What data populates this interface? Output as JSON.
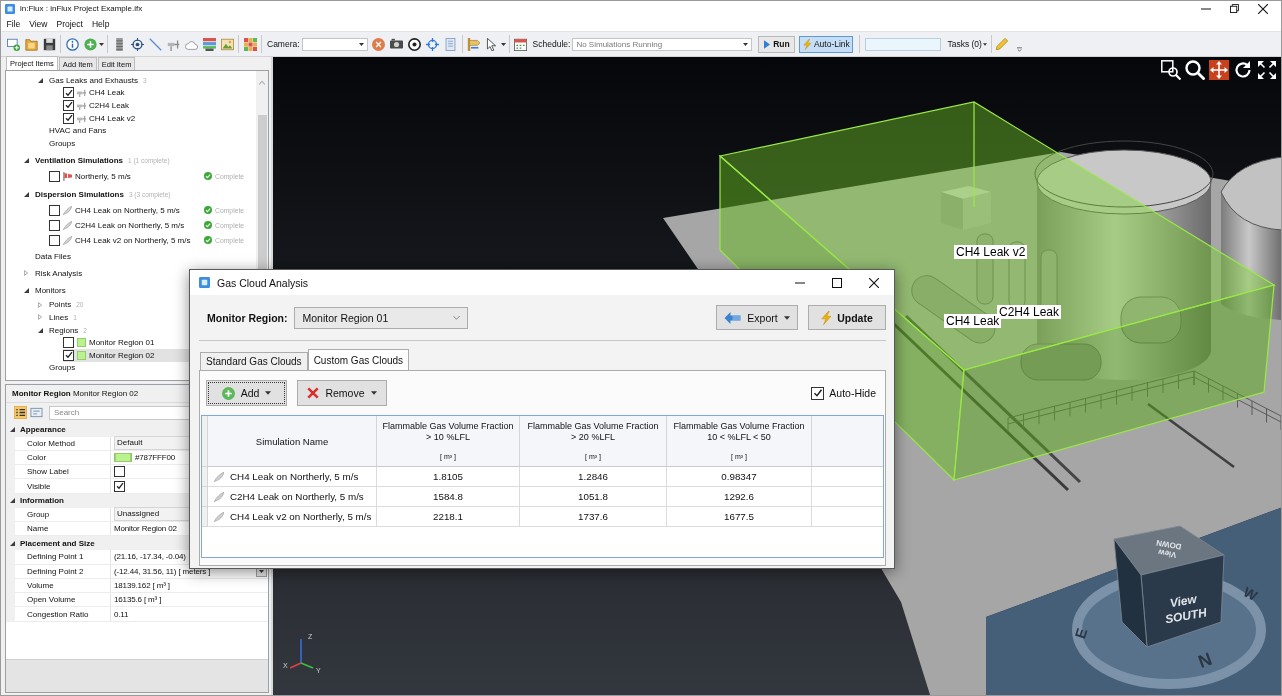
{
  "window": {
    "title": "in:Flux : inFlux Project Example.ifx"
  },
  "menu": [
    {
      "label": "File"
    },
    {
      "label": "View"
    },
    {
      "label": "Project"
    },
    {
      "label": "Help"
    }
  ],
  "toolbar": {
    "camera": {
      "label": "Camera:"
    },
    "schedule": {
      "label": "Schedule:",
      "value": "No Simulations Running"
    },
    "run": {
      "label": "Run"
    },
    "auto_link": {
      "label": "Auto-Link",
      "on": true
    },
    "tasks": {
      "label": "Tasks (0)"
    }
  },
  "left_panel": {
    "tabs": [
      {
        "label": "Project Items",
        "selected": true
      },
      {
        "label": "Add Item",
        "selected": false
      },
      {
        "label": "Edit Item",
        "selected": false
      }
    ],
    "tree": {
      "partial_branch": [
        {
          "kind": "folder",
          "label": "Gas Leaks and Exhausts",
          "count": "3",
          "expanded": true,
          "selected": false,
          "children": [
            {
              "kind": "leak",
              "label": "CH4 Leak",
              "checked": true,
              "selected": false
            },
            {
              "kind": "leak",
              "label": "C2H4 Leak",
              "checked": true,
              "selected": false
            },
            {
              "kind": "leak",
              "label": "CH4 Leak v2",
              "checked": true,
              "selected": false
            }
          ]
        },
        {
          "kind": "folder",
          "label": "HVAC and Fans",
          "selected": false
        },
        {
          "kind": "folder",
          "label": "Groups",
          "selected": false
        }
      ],
      "items": [
        {
          "kind": "section",
          "label": "Ventilation Simulations",
          "count": "1 (1 complete)",
          "expanded": true,
          "selected": false,
          "children": [
            {
              "kind": "ventilation",
              "label": "Northerly, 5 m/s",
              "checked": false,
              "status": "Complete",
              "selected": false
            }
          ]
        },
        {
          "kind": "section",
          "label": "Dispersion Simulations",
          "count": "3 (3 complete)",
          "expanded": true,
          "selected": false,
          "children": [
            {
              "kind": "dispersion",
              "label": "CH4 Leak on Northerly, 5 m/s",
              "checked": false,
              "status": "Complete",
              "selected": false
            },
            {
              "kind": "dispersion",
              "label": "C2H4 Leak on Northerly, 5 m/s",
              "checked": false,
              "status": "Complete",
              "selected": false
            },
            {
              "kind": "dispersion",
              "label": "CH4 Leak v2 on Northerly, 5 m/s",
              "checked": false,
              "status": "Complete",
              "selected": false
            }
          ]
        },
        {
          "kind": "folder",
          "label": "Data Files",
          "selected": false
        },
        {
          "kind": "folder",
          "label": "Risk Analysis",
          "expanded": false,
          "selected": false
        },
        {
          "kind": "folder",
          "label": "Monitors",
          "expanded": true,
          "selected": false,
          "children": [
            {
              "kind": "folder",
              "label": "Points",
              "count": "20",
              "expanded": false,
              "selected": false
            },
            {
              "kind": "folder",
              "label": "Lines",
              "count": "1",
              "expanded": false,
              "selected": false
            },
            {
              "kind": "folder",
              "label": "Regions",
              "count": "2",
              "expanded": true,
              "selected": false,
              "children": [
                {
                  "kind": "region",
                  "label": "Monitor Region 01",
                  "checked": false,
                  "selected": false
                },
                {
                  "kind": "region",
                  "label": "Monitor Region 02",
                  "checked": true,
                  "selected": true
                }
              ]
            },
            {
              "kind": "folder",
              "label": "Groups",
              "selected": false
            }
          ]
        }
      ]
    }
  },
  "properties": {
    "header": {
      "type": "Monitor Region",
      "name": "Monitor Region 02"
    },
    "view_modes": [
      {
        "kind": "categorized",
        "selected": true
      },
      {
        "kind": "alphabetical",
        "selected": false
      }
    ],
    "search": {
      "placeholder": "Search"
    },
    "categories": [
      {
        "label": "Appearance",
        "expanded": true,
        "rows": [
          {
            "kind": "dropdown",
            "name": "Color Method",
            "value": "Default"
          },
          {
            "kind": "color",
            "name": "Color",
            "value": "#787FFF00"
          },
          {
            "kind": "checkbox",
            "name": "Show Label",
            "checked": false
          },
          {
            "kind": "checkbox",
            "name": "Visible",
            "checked": true
          }
        ]
      },
      {
        "label": "Information",
        "expanded": true,
        "rows": [
          {
            "kind": "dropdown",
            "name": "Group",
            "value": "Unassigned"
          },
          {
            "kind": "text",
            "name": "Name",
            "value": "Monitor Region 02"
          }
        ]
      },
      {
        "label": "Placement and Size",
        "expanded": true,
        "rows": [
          {
            "kind": "text",
            "name": "Defining Point 1",
            "value": "(21.16, -17.34, -0.04)"
          },
          {
            "kind": "unit",
            "name": "Defining Point 2",
            "value": "(-12.44, 31.56, 11) [ meters ]"
          },
          {
            "kind": "text",
            "name": "Volume",
            "value": "18139.162 [ m³ ]"
          },
          {
            "kind": "text",
            "name": "Open Volume",
            "value": "16135.6 [ m³ ]"
          },
          {
            "kind": "text",
            "name": "Congestion Ratio",
            "value": "0.11"
          }
        ]
      }
    ]
  },
  "viewport": {
    "tools": [
      {
        "kind": "zoombox",
        "selected": false
      },
      {
        "kind": "zoom",
        "selected": false
      },
      {
        "kind": "pan",
        "selected": true
      },
      {
        "kind": "rotate",
        "selected": false
      },
      {
        "kind": "fullscreen",
        "selected": false
      }
    ],
    "labels": [
      "CH4 Leak v2",
      "C2H4 Leak",
      "CH4 Leak"
    ],
    "view_cube": {
      "top": [
        "View",
        "DOWN"
      ],
      "front": [
        "View",
        "SOUTH"
      ]
    },
    "compass": [
      "E",
      "N",
      "W"
    ],
    "axes": [
      "Z",
      "X",
      "Y"
    ]
  },
  "dialog": {
    "title": "Gas Cloud Analysis",
    "monitor_region": {
      "label": "Monitor Region:",
      "value": "Monitor Region 01"
    },
    "export": {
      "label": "Export"
    },
    "update": {
      "label": "Update"
    },
    "tabs": [
      {
        "label": "Standard Gas Clouds",
        "selected": false
      },
      {
        "label": "Custom Gas Clouds",
        "selected": true
      }
    ],
    "add": {
      "label": "Add"
    },
    "remove": {
      "label": "Remove"
    },
    "auto_hide": {
      "label": "Auto-Hide",
      "checked": true
    },
    "table": {
      "columns": [
        {
          "label": "Simulation Name"
        },
        {
          "label": "Flammable Gas Volume Fraction",
          "condition": "> 10 %LFL",
          "unit": "[ m³ ]"
        },
        {
          "label": "Flammable Gas Volume Fraction",
          "condition": "> 20 %LFL",
          "unit": "[ m³ ]"
        },
        {
          "label": "Flammable Gas Volume Fraction",
          "condition": "10 < %LFL < 50",
          "unit": "[ m³ ]"
        }
      ],
      "rows": [
        {
          "name": "CH4 Leak on Northerly, 5 m/s",
          "values": [
            "1.8105",
            "1.2846",
            "0.98347"
          ]
        },
        {
          "name": "C2H4 Leak on Northerly, 5 m/s",
          "values": [
            "1584.8",
            "1051.8",
            "1292.6"
          ]
        },
        {
          "name": "CH4 Leak v2 on Northerly, 5 m/s",
          "values": [
            "2218.1",
            "1737.6",
            "1677.5"
          ]
        }
      ]
    }
  }
}
